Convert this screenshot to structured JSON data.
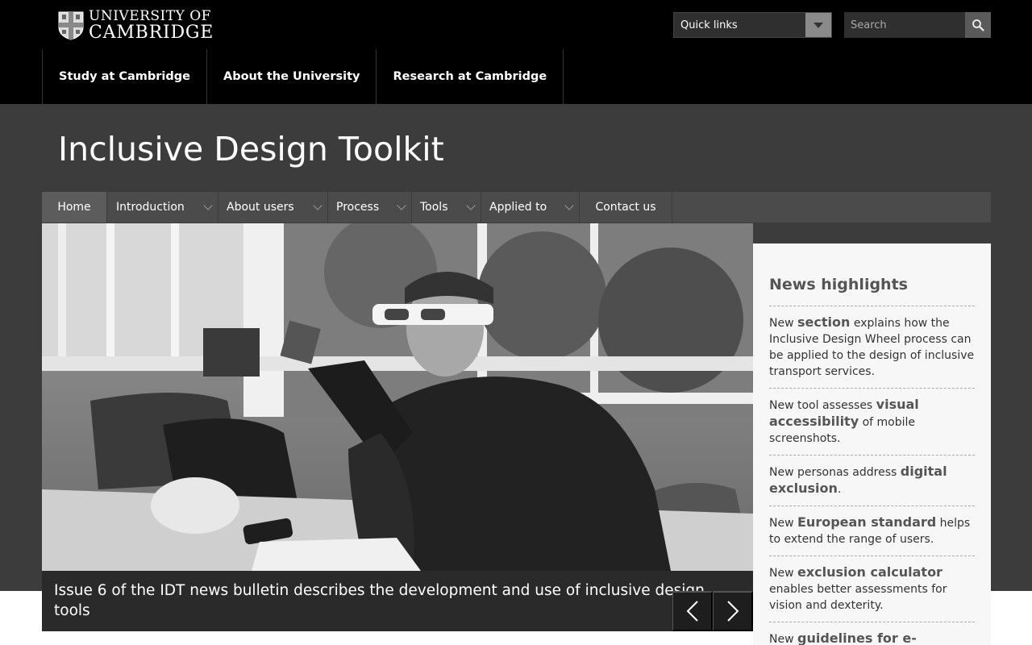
{
  "header": {
    "logo_line1": "UNIVERSITY OF",
    "logo_line2": "CAMBRIDGE",
    "quicklinks_label": "Quick links",
    "search_placeholder": "Search"
  },
  "main_nav": [
    {
      "label": "Study at Cambridge"
    },
    {
      "label": "About the University"
    },
    {
      "label": "Research at Cambridge"
    }
  ],
  "site_title": "Inclusive Design Toolkit",
  "section_nav": [
    {
      "label": "Home",
      "active": true,
      "dropdown": false
    },
    {
      "label": "Introduction",
      "dropdown": true
    },
    {
      "label": "About users",
      "dropdown": true
    },
    {
      "label": "Process",
      "dropdown": true
    },
    {
      "label": "Tools",
      "dropdown": true
    },
    {
      "label": "Applied to",
      "dropdown": true
    },
    {
      "label": "Contact us",
      "dropdown": false
    }
  ],
  "hero": {
    "caption": "Issue 6 of the IDT news bulletin describes the development and use of inclusive design tools"
  },
  "news": {
    "heading": "News highlights",
    "items": [
      {
        "pre": "New ",
        "link": "section",
        "post": " explains how the Inclusive Design Wheel process can be applied to the design of inclusive transport services."
      },
      {
        "pre": "New tool assesses ",
        "link": "visual accessibility",
        "post": " of mobile screenshots."
      },
      {
        "pre": "New personas address ",
        "link": "digital exclusion",
        "post": "."
      },
      {
        "pre": "New ",
        "link": "European standard",
        "post": " helps to extend the range of users."
      },
      {
        "pre": "New ",
        "link": "exclusion calculator",
        "post": " enables better assessments for vision and dexterity."
      },
      {
        "pre": "New ",
        "link": "guidelines for e-",
        "post": ""
      }
    ]
  },
  "colors": {
    "top_bar": "#000000",
    "band": "#3c3c3c",
    "secnav": "#4b4b4b",
    "news_bg": "#f7f7f7"
  }
}
